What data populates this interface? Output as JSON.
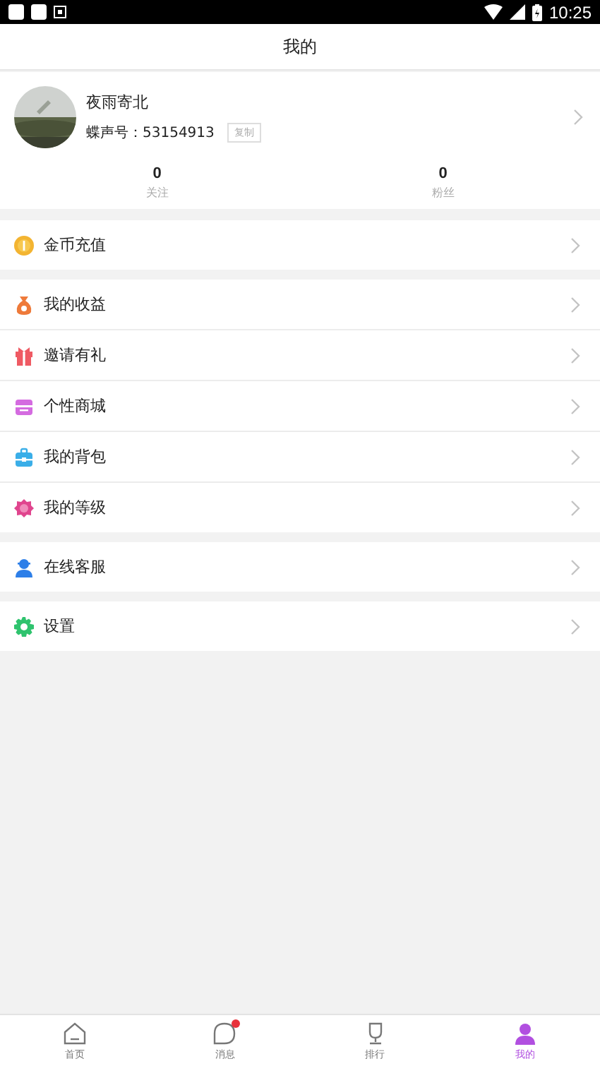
{
  "status_bar": {
    "time": "10:25"
  },
  "header": {
    "title": "我的"
  },
  "profile": {
    "name": "夜雨寄北",
    "id_label": "蝶声号：53154913",
    "copy_button": "复制"
  },
  "stats": [
    {
      "value": "0",
      "label": "关注"
    },
    {
      "value": "0",
      "label": "粉丝"
    }
  ],
  "menu_groups": [
    [
      {
        "kind": "coin",
        "label": "金币充值"
      }
    ],
    [
      {
        "kind": "moneybag",
        "label": "我的收益"
      },
      {
        "kind": "gift",
        "label": "邀请有礼"
      },
      {
        "kind": "shop",
        "label": "个性商城"
      },
      {
        "kind": "bag",
        "label": "我的背包"
      },
      {
        "kind": "level",
        "label": "我的等级"
      }
    ],
    [
      {
        "kind": "service",
        "label": "在线客服"
      }
    ],
    [
      {
        "kind": "gear",
        "label": "设置"
      }
    ]
  ],
  "tab_bar": [
    {
      "kind": "home",
      "label": "首页",
      "selected": false,
      "badge": false
    },
    {
      "kind": "message",
      "label": "消息",
      "selected": false,
      "badge": true
    },
    {
      "kind": "rank",
      "label": "排行",
      "selected": false,
      "badge": false
    },
    {
      "kind": "me",
      "label": "我的",
      "selected": true,
      "badge": false
    }
  ]
}
